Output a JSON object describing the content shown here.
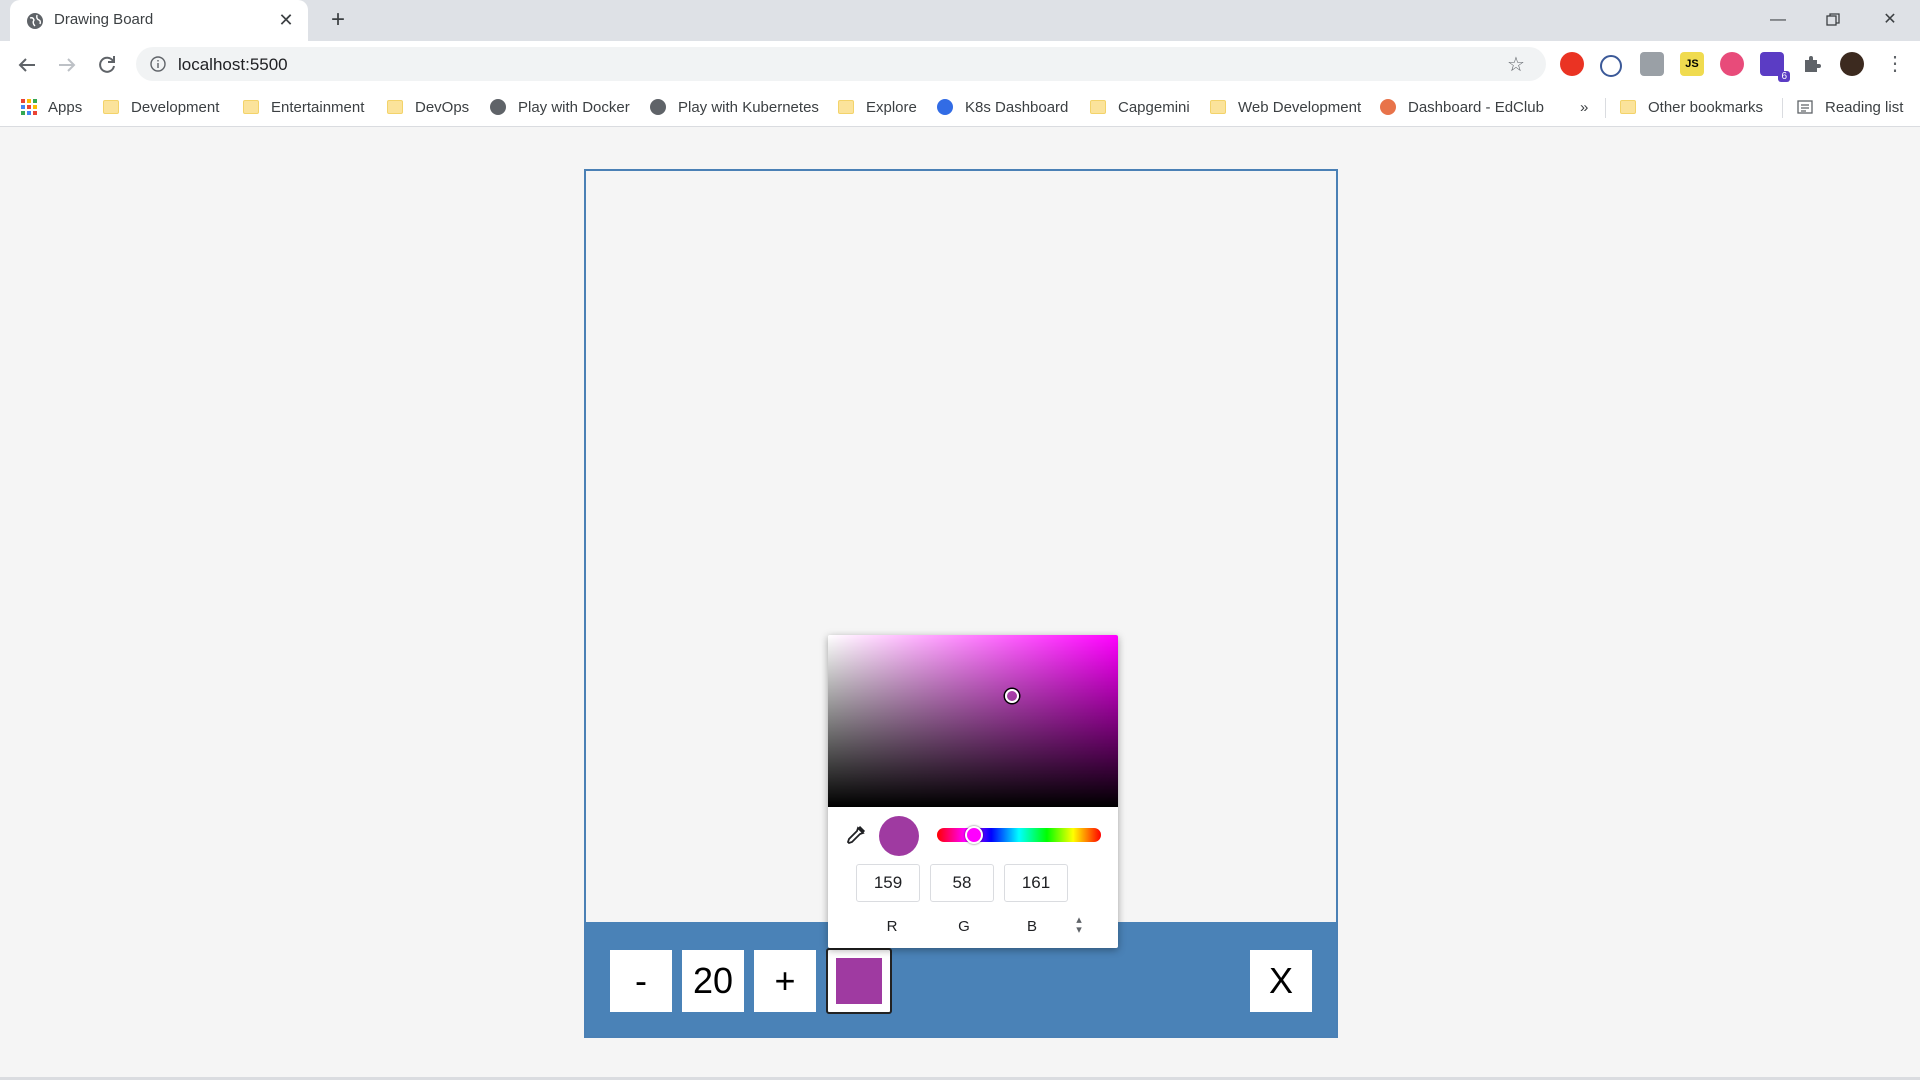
{
  "browser": {
    "tab_title": "Drawing Board",
    "url": "localhost:5500",
    "bookmarks": [
      {
        "label": "Apps",
        "icon": "apps-grid-icon"
      },
      {
        "label": "Development",
        "icon": "folder-icon"
      },
      {
        "label": "Entertainment",
        "icon": "folder-icon"
      },
      {
        "label": "DevOps",
        "icon": "folder-icon"
      },
      {
        "label": "Play with Docker",
        "icon": "globe-icon"
      },
      {
        "label": "Play with Kubernetes",
        "icon": "globe-icon"
      },
      {
        "label": "Explore",
        "icon": "folder-icon"
      },
      {
        "label": "K8s Dashboard",
        "icon": "kubernetes-icon"
      },
      {
        "label": "Capgemini",
        "icon": "folder-icon"
      },
      {
        "label": "Web Development",
        "icon": "folder-icon"
      },
      {
        "label": "Dashboard - EdClub",
        "icon": "edclub-icon"
      }
    ],
    "overflow_label": "»",
    "other_bookmarks": "Other bookmarks",
    "reading_list": "Reading list",
    "extension_badge": "6"
  },
  "toolbar": {
    "decrease_label": "-",
    "size_value": "20",
    "increase_label": "+",
    "clear_label": "X",
    "current_color": "#9f3aa1"
  },
  "picker": {
    "r": "159",
    "g": "58",
    "b": "161",
    "r_label": "R",
    "g_label": "G",
    "b_label": "B",
    "hue_color": "#ff00ff",
    "preview_color": "#9f3aa1"
  }
}
